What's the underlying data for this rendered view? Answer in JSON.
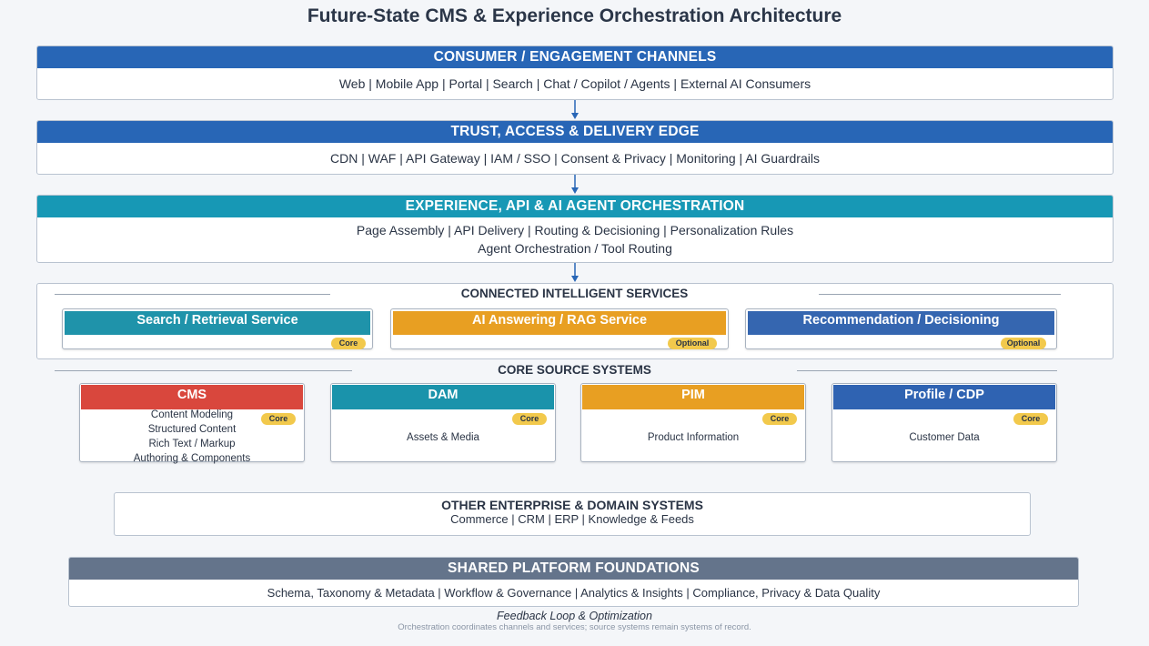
{
  "title": "Future-State CMS & Experience Orchestration Architecture",
  "layers": {
    "consumer": {
      "header": "CONSUMER / ENGAGEMENT CHANNELS",
      "body": "Web | Mobile App | Portal | Search | Chat / Copilot / Agents | External AI Consumers"
    },
    "trust": {
      "header": "TRUST, ACCESS & DELIVERY EDGE",
      "body": "CDN | WAF | API Gateway | IAM / SSO | Consent & Privacy | Monitoring | AI Guardrails"
    },
    "orchestration": {
      "header": "EXPERIENCE, API & AI AGENT ORCHESTRATION",
      "body_line1": "Page Assembly | API Delivery | Routing & Decisioning | Personalization Rules",
      "body_line2": "Agent Orchestration / Tool Routing"
    }
  },
  "services": {
    "label": "CONNECTED INTELLIGENT SERVICES",
    "items": [
      {
        "name": "Search / Retrieval Service",
        "badge": "Core",
        "color": "#1f93aa"
      },
      {
        "name": "AI Answering / RAG Service",
        "badge": "Optional",
        "color": "#e89f22"
      },
      {
        "name": "Recommendation / Decisioning",
        "badge": "Optional",
        "color": "#3566b0"
      }
    ]
  },
  "sources": {
    "label": "CORE SOURCE SYSTEMS",
    "items": [
      {
        "name": "CMS",
        "badge": "Core",
        "color": "#d9473d",
        "lines": [
          "Content Modeling",
          "Structured Content",
          "Rich Text / Markup",
          "Authoring & Components"
        ]
      },
      {
        "name": "DAM",
        "badge": "Core",
        "color": "#1a93ab",
        "lines": [
          "Assets & Media"
        ]
      },
      {
        "name": "PIM",
        "badge": "Core",
        "color": "#e89f22",
        "lines": [
          "Product Information"
        ]
      },
      {
        "name": "Profile / CDP",
        "badge": "Core",
        "color": "#2f63b2",
        "lines": [
          "Customer Data"
        ]
      }
    ]
  },
  "other": {
    "header": "OTHER ENTERPRISE & DOMAIN SYSTEMS",
    "body": "Commerce | CRM | ERP | Knowledge & Feeds"
  },
  "foundations": {
    "header": "SHARED PLATFORM FOUNDATIONS",
    "body": "Schema, Taxonomy & Metadata | Workflow & Governance | Analytics & Insights | Compliance, Privacy & Data Quality"
  },
  "footer": {
    "feedback": "Feedback Loop & Optimization",
    "note": "Orchestration coordinates channels and services; source systems remain systems of record."
  }
}
